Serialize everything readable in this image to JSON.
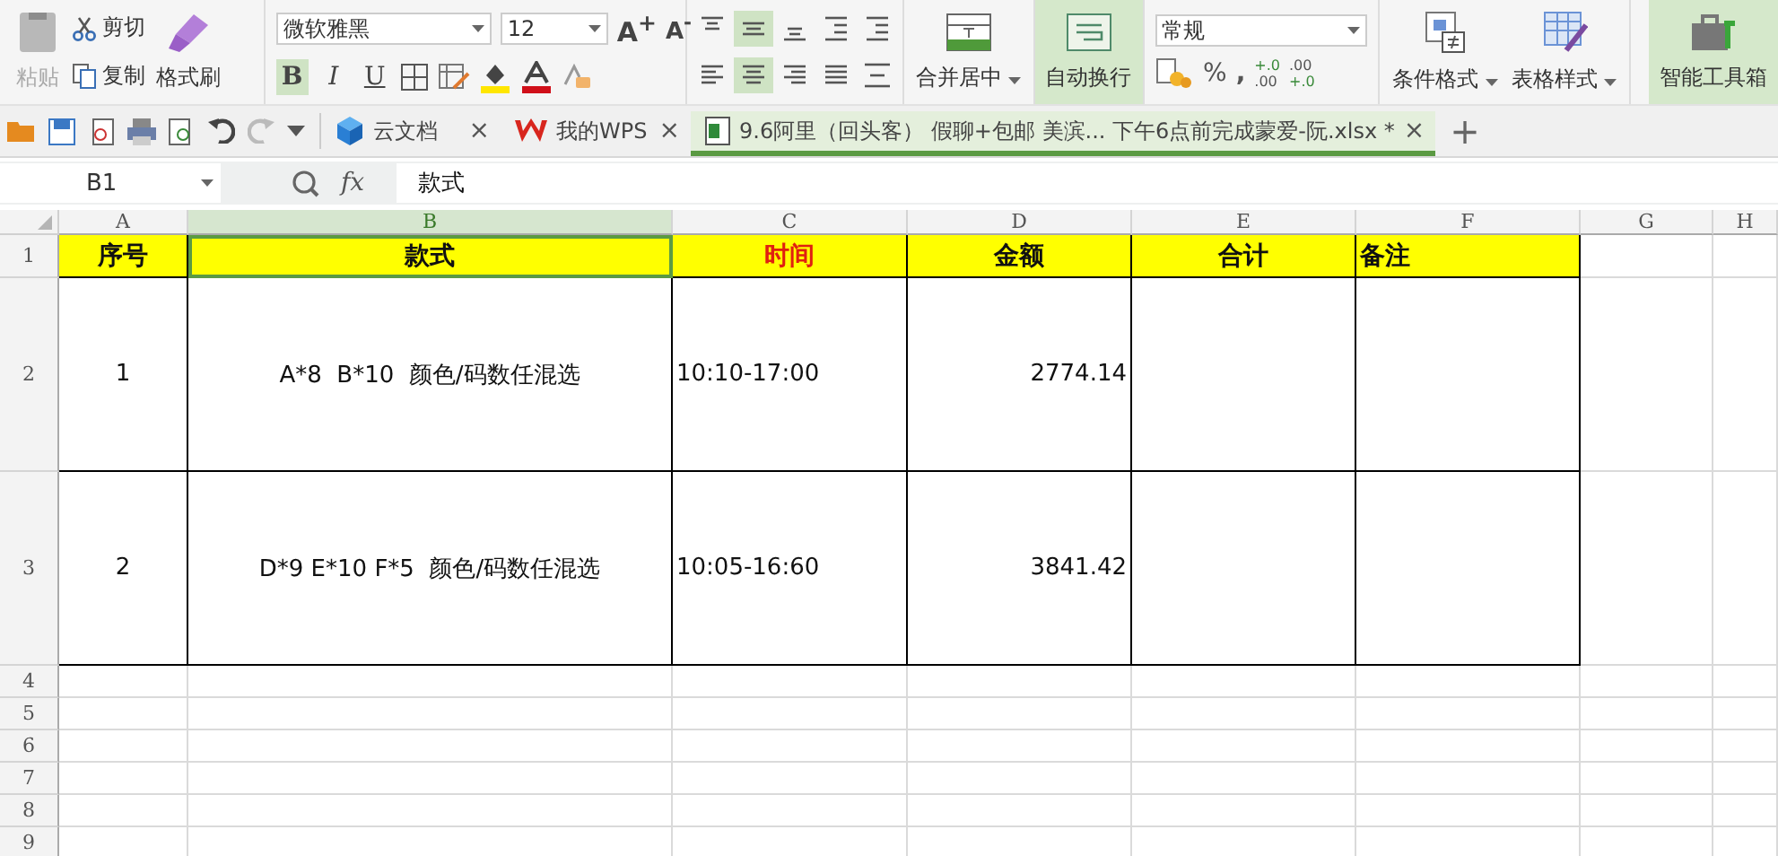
{
  "ribbon": {
    "clipboard": {
      "paste": "粘贴",
      "paste_disabled": true,
      "cut": "剪切",
      "copy": "复制",
      "painter": "格式刷"
    },
    "font": {
      "name": "微软雅黑",
      "size": "12",
      "grow": "A$^{+}$",
      "shrink": "A$^{-}$",
      "styles": [
        {
          "label": "B",
          "kind": "bold",
          "selected": true
        },
        {
          "label": "I",
          "kind": "italic",
          "selected": false
        },
        {
          "label": "U",
          "kind": "underline",
          "selected": false
        }
      ]
    },
    "align_top": [
      {
        "kind": "top",
        "selected": false
      },
      {
        "kind": "middle",
        "selected": true
      },
      {
        "kind": "bottom",
        "selected": false
      },
      {
        "kind": "outdent",
        "selected": false
      },
      {
        "kind": "indent",
        "selected": false
      }
    ],
    "align_bottom": [
      {
        "kind": "left",
        "selected": false
      },
      {
        "kind": "center",
        "selected": true
      },
      {
        "kind": "right",
        "selected": false
      },
      {
        "kind": "justify",
        "selected": false
      },
      {
        "kind": "distributed",
        "selected": false
      }
    ],
    "merge": "合并居中",
    "wrap": {
      "label": "自动换行",
      "selected": true
    },
    "number": {
      "format": "常规",
      "percent": "%",
      "comma": ",",
      "increase": [
        "+.0",
        ".00"
      ],
      "decrease": [
        ".00",
        "+.0"
      ]
    },
    "conditional": "条件格式",
    "table_style": "表格样式",
    "toolbox": "智能工具箱"
  },
  "tabs": [
    {
      "label": "云文档",
      "kind": "cloud",
      "close": "×",
      "selected": false
    },
    {
      "label": "我的WPS",
      "kind": "wps",
      "close": "×",
      "selected": false
    },
    {
      "label": "9.6阿里（回头客） 假聊+包邮 美滨... 下午6点前完成蒙爱-阮.xlsx *",
      "kind": "sheet",
      "close": "×",
      "selected": true
    }
  ],
  "new_tab": "+",
  "formula_bar": {
    "name_box": "B1",
    "fx": "fx",
    "value": "款式"
  },
  "columns": [
    {
      "label": "A",
      "selected": false
    },
    {
      "label": "B",
      "selected": true
    },
    {
      "label": "C",
      "selected": false
    },
    {
      "label": "D",
      "selected": false
    },
    {
      "label": "E",
      "selected": false
    },
    {
      "label": "F",
      "selected": false
    },
    {
      "label": "G",
      "selected": false
    },
    {
      "label": "H",
      "selected": false
    }
  ],
  "rows": [
    {
      "num": "1",
      "kind": "header",
      "cells": [
        {
          "text": "序号",
          "kind": "plain",
          "selected": false
        },
        {
          "text": "款式",
          "kind": "plain",
          "selected": true
        },
        {
          "text": "时间",
          "kind": "accent",
          "selected": false
        },
        {
          "text": "金额",
          "kind": "plain",
          "selected": false
        },
        {
          "text": "合计",
          "kind": "plain",
          "selected": false
        },
        {
          "text": "备注",
          "kind": "plain",
          "selected": false
        }
      ]
    },
    {
      "num": "2",
      "kind": "data",
      "cells": [
        {
          "text": "1",
          "selected": false
        },
        {
          "text": "A*8  B*10  颜色/码数任混选",
          "selected": false
        },
        {
          "text": "10:10-17:00",
          "selected": false
        },
        {
          "text": "2774.14",
          "selected": false
        },
        {
          "selected": false
        },
        {
          "selected": false
        }
      ]
    },
    {
      "num": "3",
      "kind": "data",
      "cells": [
        {
          "text": "2",
          "selected": false
        },
        {
          "text": "D*9 E*10 F*5  颜色/码数任混选",
          "selected": false
        },
        {
          "text": "10:05-16:60",
          "selected": false
        },
        {
          "text": "3841.42",
          "selected": false
        },
        {
          "selected": false
        },
        {
          "selected": false
        }
      ]
    },
    {
      "num": "4",
      "kind": "empty"
    },
    {
      "num": "5",
      "kind": "empty"
    },
    {
      "num": "6",
      "kind": "empty"
    },
    {
      "num": "7",
      "kind": "empty"
    },
    {
      "num": "8",
      "kind": "empty"
    },
    {
      "num": "9",
      "kind": "empty"
    }
  ]
}
